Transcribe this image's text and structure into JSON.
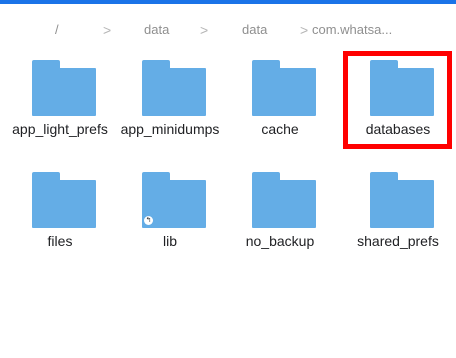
{
  "breadcrumb": {
    "root": "/",
    "separator": ">",
    "items": [
      "data",
      "data",
      "com.whatsa..."
    ]
  },
  "folders": [
    {
      "label": "app_light_prefs",
      "icon": "folder-icon"
    },
    {
      "label": "app_minidumps",
      "icon": "folder-icon"
    },
    {
      "label": "cache",
      "icon": "folder-icon"
    },
    {
      "label": "databases",
      "icon": "folder-icon",
      "highlighted": true
    },
    {
      "label": "files",
      "icon": "folder-icon"
    },
    {
      "label": "lib",
      "icon": "folder-link-icon",
      "badge": "↰"
    },
    {
      "label": "no_backup",
      "icon": "folder-icon"
    },
    {
      "label": "shared_prefs",
      "icon": "folder-icon"
    }
  ],
  "colors": {
    "accent": "#1a73e8",
    "folder": "#64ade6",
    "highlight": "#ff0000"
  }
}
